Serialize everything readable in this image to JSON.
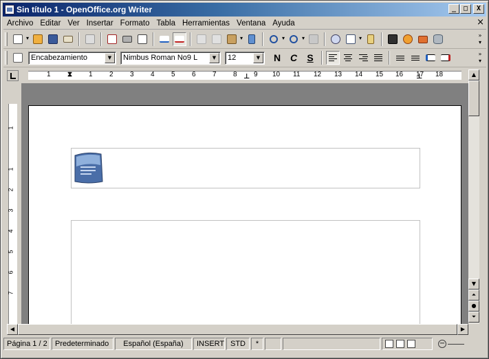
{
  "window": {
    "title": "Sin título 1 - OpenOffice.org Writer",
    "buttons": {
      "minimize": "_",
      "maximize": "□",
      "close": "X"
    }
  },
  "menubar": {
    "items": [
      "Archivo",
      "Editar",
      "Ver",
      "Insertar",
      "Formato",
      "Tabla",
      "Herramientas",
      "Ventana",
      "Ayuda"
    ],
    "close_glyph": "×"
  },
  "toolbar_standard": {
    "icons": [
      "new-icon",
      "open-icon",
      "save-icon",
      "email-icon",
      "edit-file-icon",
      "export-pdf-icon",
      "print-icon",
      "page-preview-icon",
      "spellcheck-icon",
      "autospellcheck-icon",
      "cut-icon",
      "copy-icon",
      "paste-icon",
      "clone-format-icon",
      "undo-icon",
      "redo-icon",
      "hyperlink-icon",
      "navigator-icon",
      "table-icon",
      "draw-functions-icon",
      "find-icon",
      "gallery-icon",
      "datasources-icon",
      "database-icon"
    ]
  },
  "toolbar_format": {
    "paragraph_style": "Encabezamiento",
    "font_name": "Nimbus Roman No9 L",
    "font_size": "12",
    "bold": "N",
    "italic": "C",
    "underline": "S"
  },
  "ruler": {
    "h_numbers": [
      "1",
      "1",
      "2",
      "3",
      "4",
      "5",
      "6",
      "7",
      "8",
      "9",
      "10",
      "11",
      "12",
      "13",
      "14",
      "15",
      "16",
      "17",
      "18"
    ],
    "v_numbers": [
      "1",
      "1",
      "2",
      "3",
      "4",
      "5",
      "6",
      "7"
    ]
  },
  "statusbar": {
    "page": "Página  1 / 2",
    "style": "Predeterminado",
    "language": "Español (España)",
    "insert_mode": "INSERT",
    "selection_mode": "STD",
    "modified": "*"
  },
  "colors": {
    "title_start": "#0a246a",
    "title_end": "#a6caf0",
    "chrome": "#d4d0c8",
    "doc_bg": "#808080"
  }
}
